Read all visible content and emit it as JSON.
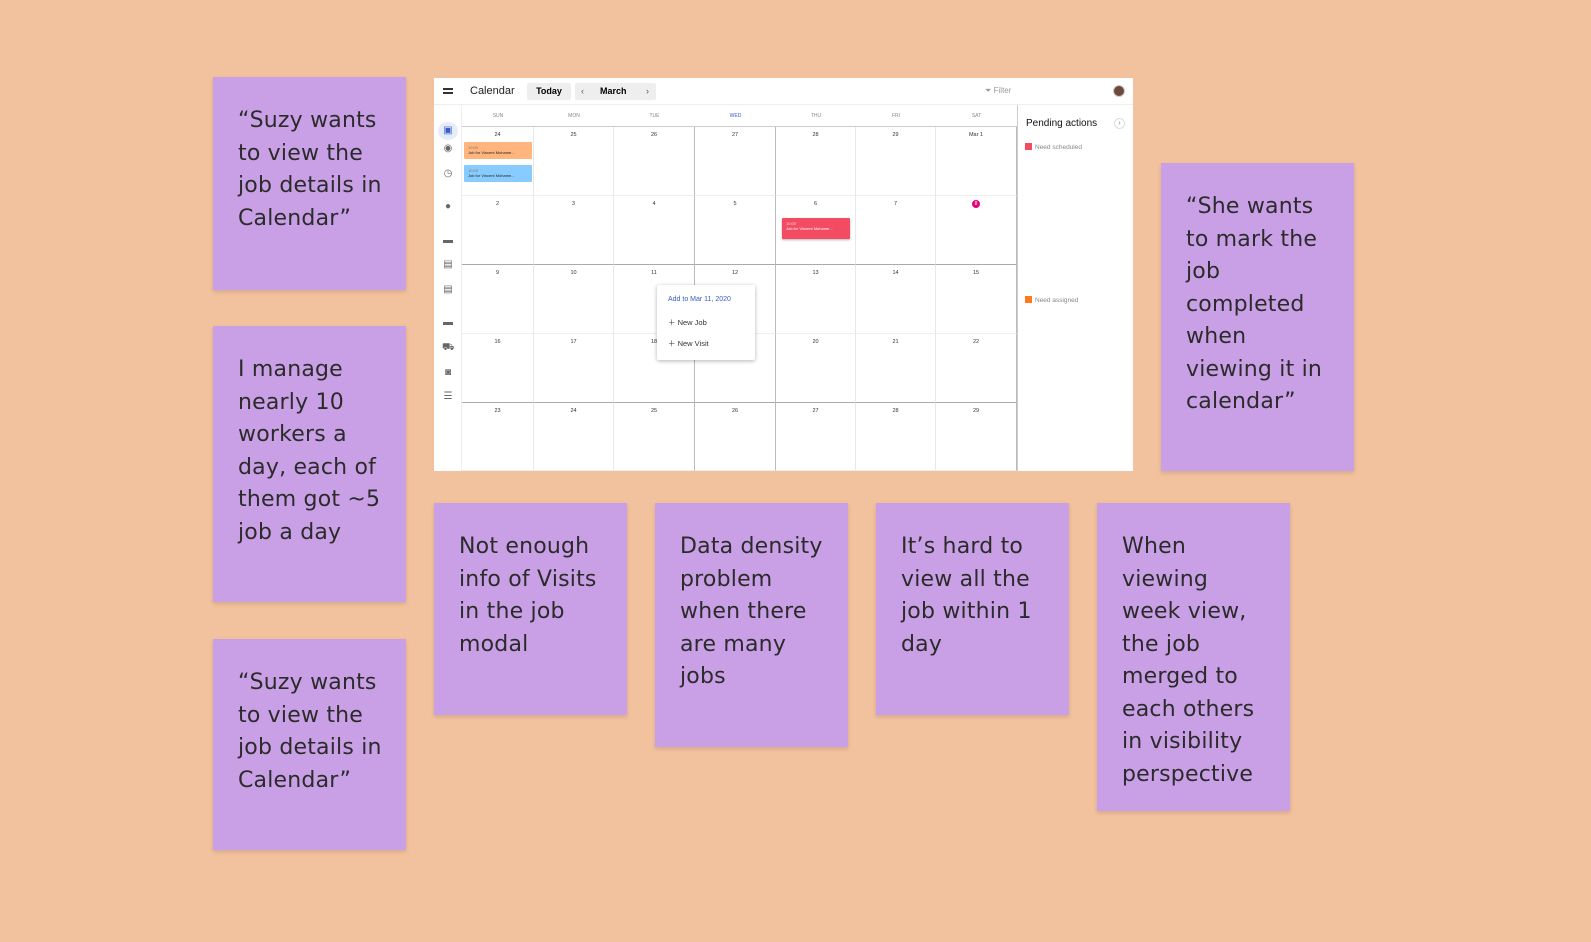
{
  "notes": [
    "“Suzy wants to view the job details in Calendar”",
    "I manage nearly 10 workers a day, each of them got ~5 job a day",
    "“Suzy wants to view the job details in Calendar”",
    "Not enough info of Visits in the job modal",
    "Data density problem when there are many jobs",
    "It’s hard to view all the job within 1 day",
    "When viewing week view, the job merged to each others in visibility perspective",
    "“She wants to mark the job completed when viewing it in calendar”"
  ],
  "calendar": {
    "title": "Calendar",
    "today": "Today",
    "month": "March",
    "prev": "‹",
    "next": "›",
    "filter": "Filter",
    "weekdays": [
      "SUN",
      "MON",
      "TUE",
      "WED",
      "THU",
      "FRI",
      "SAT"
    ],
    "weeks": [
      [
        "24",
        "25",
        "26",
        "27",
        "28",
        "29",
        "Mar 1"
      ],
      [
        "2",
        "3",
        "4",
        "5",
        "6",
        "7",
        "8"
      ],
      [
        "9",
        "10",
        "11",
        "12",
        "13",
        "14",
        "15"
      ],
      [
        "16",
        "17",
        "18",
        "19",
        "20",
        "21",
        "22"
      ],
      [
        "23",
        "24",
        "25",
        "26",
        "27",
        "28",
        "29"
      ]
    ],
    "today_date": "8",
    "events": [
      {
        "time": "10:00",
        "title": "Job for Vincent Mohame...",
        "color": "#ffb57d"
      },
      {
        "time": "10:00",
        "title": "Job for Vincent Mohame...",
        "color": "#88ccff"
      },
      {
        "time": "10:00",
        "title": "Job for Vincent Mohame...",
        "color": "#f24b62"
      }
    ],
    "pending": {
      "title": "Pending actions",
      "chevron": "›",
      "need_scheduled": "Need scheduled",
      "need_assigned": "Need assigned"
    },
    "popup": {
      "title": "Add to Mar 11, 2020",
      "items": [
        "New Job",
        "New Visit"
      ]
    },
    "colors": {
      "accent": "#3b5cc4",
      "today": "#e6007a"
    }
  }
}
